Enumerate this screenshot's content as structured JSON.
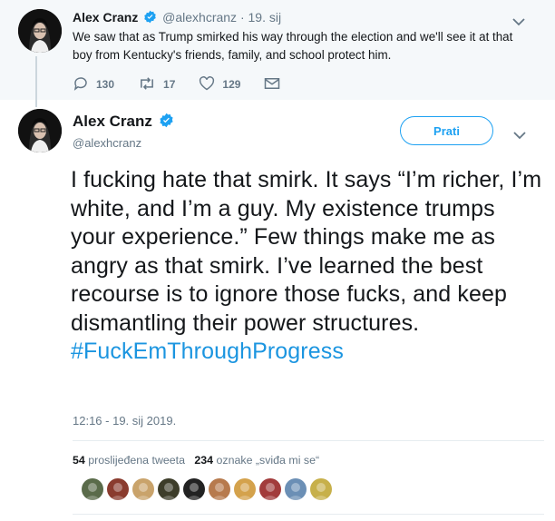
{
  "parent_tweet": {
    "name": "Alex Cranz",
    "handle": "@alexhcranz",
    "separator": "·",
    "date": "19. sij",
    "text": "We saw that as Trump smirked his way through the election and we'll see it at that boy from Kentucky's friends, family, and school protect him.",
    "replies": "130",
    "retweets": "17",
    "likes": "129"
  },
  "main_tweet": {
    "name": "Alex Cranz",
    "handle": "@alexhcranz",
    "follow_label": "Prati",
    "text": "I fucking hate that smirk. It says “I’m richer, I’m white, and I’m a guy. My existence trumps your experience.” Few things make me as angry as that smirk. I’ve learned the best recourse is to ignore those fucks, and keep dismantling their power structures.",
    "hashtag": "#FuckEmThroughProgress",
    "timestamp": "12:16 - 19. sij 2019.",
    "retweet_count": "54",
    "retweet_label": "proslijeđena tweeta",
    "like_count": "234",
    "like_label": "oznake „sviđa mi se“"
  },
  "colors": {
    "accent": "#1da1f2",
    "hashtag": "#1b95e0",
    "muted": "#657786",
    "parent_bg": "#f5f8fa"
  },
  "icons": [
    "verified-badge-icon",
    "caret-down-icon",
    "reply-icon",
    "retweet-icon",
    "like-icon",
    "direct-message-icon"
  ],
  "likers": [
    {
      "color": "#5a6b4a"
    },
    {
      "color": "#8a3b2e"
    },
    {
      "color": "#c9a36b"
    },
    {
      "color": "#3d3d2a"
    },
    {
      "color": "#222222"
    },
    {
      "color": "#b77a4d"
    },
    {
      "color": "#d4a24c"
    },
    {
      "color": "#a23b3b"
    },
    {
      "color": "#6b8fb5"
    },
    {
      "color": "#c7b04a"
    }
  ]
}
